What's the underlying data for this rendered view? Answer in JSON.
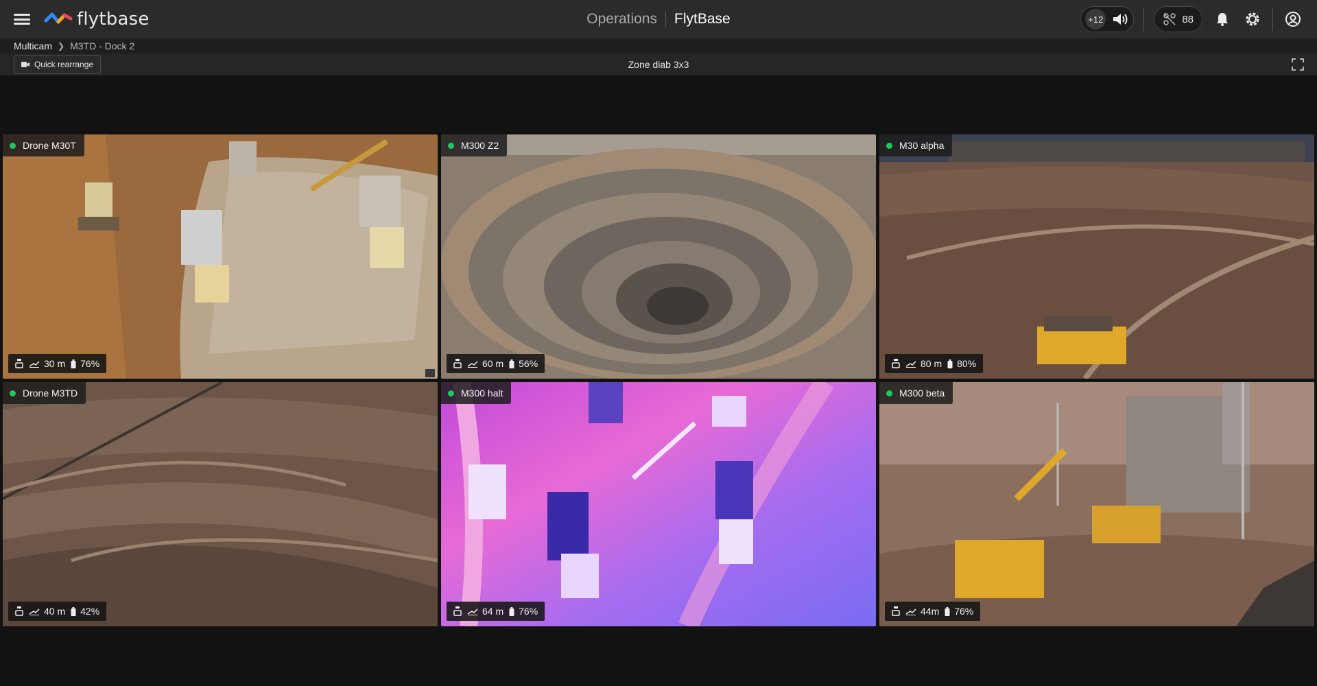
{
  "header": {
    "logo_text": "flytbase",
    "section": "Operations",
    "brand": "FlytBase",
    "notification_count": "+12",
    "drone_count": "88"
  },
  "breadcrumb": {
    "root": "Multicam",
    "current": "M3TD - Dock 2"
  },
  "toolbar": {
    "quick_rearrange": "Quick rearrange",
    "zone_title": "Zone diab 3x3"
  },
  "tiles": [
    {
      "name": "Drone M30T",
      "altitude": "30 m",
      "battery": "76%",
      "status": "online"
    },
    {
      "name": "M300 Z2",
      "altitude": "60 m",
      "battery": "56%",
      "status": "online"
    },
    {
      "name": "M30 alpha",
      "altitude": "80 m",
      "battery": "80%",
      "status": "online"
    },
    {
      "name": "Drone M3TD",
      "altitude": "40 m",
      "battery": "42%",
      "status": "online"
    },
    {
      "name": "M300 halt",
      "altitude": "64 m",
      "battery": "76%",
      "status": "online"
    },
    {
      "name": "M300 beta",
      "altitude": "44m",
      "battery": "76%",
      "status": "online"
    }
  ],
  "colors": {
    "status_online": "#22c55e",
    "topbar": "#2b2b2b",
    "background": "#121212"
  }
}
